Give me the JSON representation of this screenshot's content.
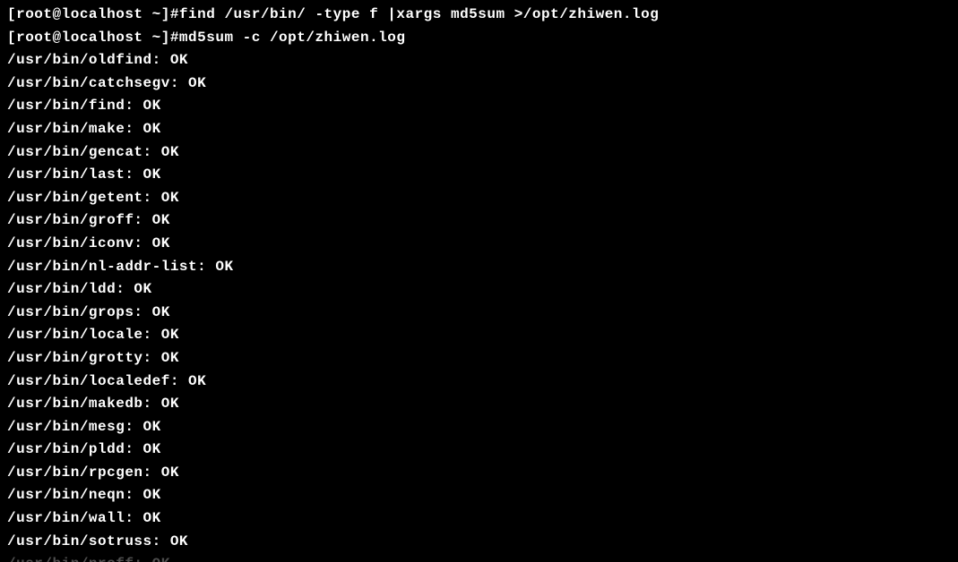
{
  "terminal": {
    "lines": [
      "[root@localhost ~]#find /usr/bin/ -type f |xargs md5sum >/opt/zhiwen.log",
      "[root@localhost ~]#md5sum -c /opt/zhiwen.log",
      "/usr/bin/oldfind: OK",
      "/usr/bin/catchsegv: OK",
      "/usr/bin/find: OK",
      "/usr/bin/make: OK",
      "/usr/bin/gencat: OK",
      "/usr/bin/last: OK",
      "/usr/bin/getent: OK",
      "/usr/bin/groff: OK",
      "/usr/bin/iconv: OK",
      "/usr/bin/nl-addr-list: OK",
      "/usr/bin/ldd: OK",
      "/usr/bin/grops: OK",
      "/usr/bin/locale: OK",
      "/usr/bin/grotty: OK",
      "/usr/bin/localedef: OK",
      "/usr/bin/makedb: OK",
      "/usr/bin/mesg: OK",
      "/usr/bin/pldd: OK",
      "/usr/bin/rpcgen: OK",
      "/usr/bin/neqn: OK",
      "/usr/bin/wall: OK",
      "/usr/bin/sotruss: OK"
    ],
    "partial_line": "/usr/bin/nroff: OK"
  }
}
